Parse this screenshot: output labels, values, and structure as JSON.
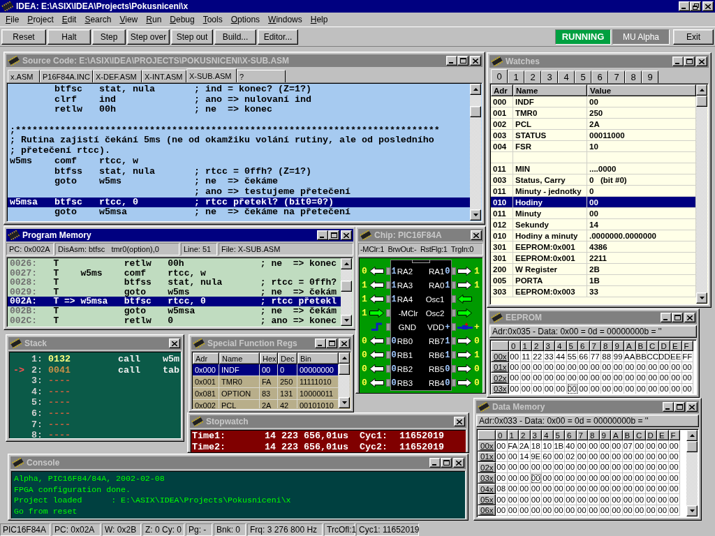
{
  "app": {
    "title": "IDEA: E:\\ASIX\\IDEA\\Projects\\Pokusniceni\\x"
  },
  "menu": [
    "File",
    "Project",
    "Edit",
    "Search",
    "View",
    "Run",
    "Debug",
    "Tools",
    "Options",
    "Windows",
    "Help"
  ],
  "toolbar": {
    "buttons": [
      "Reset",
      "Halt",
      "Step",
      "Step over",
      "Step out",
      "Build...",
      "Editor..."
    ],
    "status": {
      "label": "RUNNING",
      "on": true
    },
    "target": "MU Alpha",
    "exit": "Exit"
  },
  "source_window": {
    "title": "Source Code: E:\\ASIX\\IDEA\\PROJECTS\\POKUSNICENI\\X-SUB.ASM",
    "active": false,
    "kind": "full",
    "tabs": [
      {
        "label": "x.ASM",
        "selected": false
      },
      {
        "label": "P16F84A.INC",
        "selected": false
      },
      {
        "label": "X-DEF.ASM",
        "selected": false
      },
      {
        "label": "X-INT.ASM",
        "selected": false
      },
      {
        "label": "X-SUB.ASM",
        "selected": true
      },
      {
        "label": "?",
        "selected": false
      }
    ],
    "lines": [
      {
        "kind": "code",
        "text": "        btfsc   stat, nula       ; ind = konec? (Z=1?)",
        "selected": false
      },
      {
        "kind": "code",
        "text": "        clrf    ind              ; ano => nulovaní ind",
        "selected": false
      },
      {
        "kind": "code",
        "text": "        retlw   00h              ; ne  => konec",
        "selected": false
      },
      {
        "kind": "blank",
        "selected": false
      },
      {
        "kind": "code",
        "text": ";****************************************************************************",
        "selected": false
      },
      {
        "kind": "code",
        "text": "; Rutina zajistí čekání 5ms (ne od okamžiku volání rutiny, ale od posledního",
        "selected": false
      },
      {
        "kind": "code",
        "text": "; přetečení rtcc).",
        "selected": false
      },
      {
        "kind": "code",
        "text": "w5ms    comf    rtcc, w",
        "selected": false
      },
      {
        "kind": "code",
        "text": "        btfss   stat, nula       ; rtcc = 0ffh? (Z=1?)",
        "selected": false
      },
      {
        "kind": "code",
        "text": "        goto    w5ms             ; ne  => čekáme",
        "selected": false
      },
      {
        "kind": "code",
        "text": "                                 ; ano => testujeme přetečení",
        "selected": false
      },
      {
        "kind": "code",
        "text": "w5msa   btfsc   rtcc, 0          ; rtcc přetekl? (bit0=0?)",
        "selected": true
      },
      {
        "kind": "code",
        "text": "        goto    w5msa            ; ne  => čekáme na přetečení",
        "selected": false
      }
    ]
  },
  "watches": {
    "title": "Watches",
    "active": false,
    "kind": "full",
    "tabs": [
      {
        "label": "0",
        "selected": true
      },
      {
        "label": "1",
        "selected": false
      },
      {
        "label": "2",
        "selected": false
      },
      {
        "label": "3",
        "selected": false
      },
      {
        "label": "4",
        "selected": false
      },
      {
        "label": "5",
        "selected": false
      },
      {
        "label": "6",
        "selected": false
      },
      {
        "label": "7",
        "selected": false
      },
      {
        "label": "8",
        "selected": false
      },
      {
        "label": "9",
        "selected": false
      }
    ],
    "columns": [
      "Adr",
      "Name",
      "Value"
    ],
    "rows": [
      {
        "kind": "entry",
        "adr": "000",
        "name": "INDF",
        "value": "00",
        "selected": false
      },
      {
        "kind": "entry",
        "adr": "001",
        "name": "TMR0",
        "value": "250",
        "selected": false
      },
      {
        "kind": "entry",
        "adr": "002",
        "name": "PCL",
        "value": "2A",
        "selected": false
      },
      {
        "kind": "entry",
        "adr": "003",
        "name": "STATUS",
        "value": "00011000",
        "selected": false
      },
      {
        "kind": "entry",
        "adr": "004",
        "name": "FSR",
        "value": "10",
        "selected": false
      },
      {
        "kind": "blank",
        "selected": false
      },
      {
        "kind": "entry",
        "adr": "011",
        "name": "MIN",
        "value": "....0000",
        "selected": false
      },
      {
        "kind": "entry",
        "adr": "003",
        "name": "Status, Carry",
        "value": "0   (bit #0)",
        "selected": false
      },
      {
        "kind": "entry",
        "adr": "011",
        "name": "Minuty - jednotky",
        "value": "0",
        "selected": false
      },
      {
        "kind": "entry",
        "adr": "010",
        "name": "Hodiny",
        "value": "00",
        "selected": true
      },
      {
        "kind": "entry",
        "adr": "011",
        "name": "Minuty",
        "value": "00",
        "selected": false
      },
      {
        "kind": "entry",
        "adr": "012",
        "name": "Sekundy",
        "value": "14",
        "selected": false
      },
      {
        "kind": "entry",
        "adr": "010",
        "name": "Hodiny a minuty",
        "value": ".0000000.0000000",
        "selected": false
      },
      {
        "kind": "entry",
        "adr": "301",
        "name": "EEPROM:0x001",
        "value": "4386",
        "selected": false
      },
      {
        "kind": "entry",
        "adr": "301",
        "name": "EEPROM:0x001",
        "value": "2211",
        "selected": false
      },
      {
        "kind": "entry",
        "adr": "200",
        "name": "W Register",
        "value": "2B",
        "selected": false
      },
      {
        "kind": "entry",
        "adr": "005",
        "name": "PORTA",
        "value": "1B",
        "selected": false
      },
      {
        "kind": "entry",
        "adr": "303",
        "name": "EEPROM:0x003",
        "value": "33",
        "selected": false
      }
    ]
  },
  "program_memory": {
    "title": "Program Memory",
    "active": true,
    "kind": "full",
    "info": [
      "PC: 0x002A",
      "DisAsm: btfsc   tmr0(option),0",
      "Line: 51",
      "File: X-SUB.ASM"
    ],
    "lines": [
      {
        "address": "0026:",
        "text": "T            retlw   00h              ; ne  => konec",
        "selected": false
      },
      {
        "address": "0027:",
        "text": "T    w5ms    comf    rtcc, w",
        "selected": false
      },
      {
        "address": "0028:",
        "text": "T            btfss   stat, nula       ; rtcc = 0ffh?",
        "selected": false
      },
      {
        "address": "0029:",
        "text": "T            goto    w5ms             ; ne  => čekám",
        "selected": false
      },
      {
        "address": "002A:",
        "text": "T => w5msa   btfsc   rtcc, 0          ; rtcc přetekl",
        "selected": true
      },
      {
        "address": "002B:",
        "text": "T            goto    w5msa            ; ne  => čekám",
        "selected": false
      },
      {
        "address": "002C:",
        "text": "T            retlw   0                ; ano => konec",
        "selected": false
      }
    ]
  },
  "chip": {
    "title": "Chip: PIC16F84A",
    "active": false,
    "kind": "close_only",
    "status": "-MClr:1  BrwOut:-  RstFlg:1  TrgIn:0",
    "left_pins": [
      {
        "name": "RA2",
        "kind": "out",
        "color": "#ffffff",
        "inner": "1",
        "outer": "0"
      },
      {
        "name": "RA3",
        "kind": "out",
        "color": "#ffffff",
        "inner": "1",
        "outer": "1"
      },
      {
        "name": "RA4",
        "kind": "out",
        "color": "#ffffff",
        "inner": "1",
        "outer": "1"
      },
      {
        "name": "-MClr",
        "kind": "in",
        "color": "#00ff00",
        "outer": "1"
      },
      {
        "name": "GND",
        "kind": "ground"
      },
      {
        "name": "RB0",
        "kind": "out",
        "color": "#ffffff",
        "inner": "0",
        "outer": "0"
      },
      {
        "name": "RB1",
        "kind": "out",
        "color": "#ffffff",
        "inner": "0",
        "outer": "0"
      },
      {
        "name": "RB2",
        "kind": "out",
        "color": "#ffffff",
        "inner": "0",
        "outer": "0"
      },
      {
        "name": "RB3",
        "kind": "out",
        "color": "#ffffff",
        "inner": "0",
        "outer": "0"
      }
    ],
    "right_pins": [
      {
        "name": "RA1",
        "kind": "out",
        "color": "#ffffff",
        "inner": "0",
        "outer": "1"
      },
      {
        "name": "RA0",
        "kind": "out",
        "color": "#ffffff",
        "inner": "1",
        "outer": "1"
      },
      {
        "name": "Osc1",
        "kind": "in",
        "color": "#00ff00"
      },
      {
        "name": "Osc2",
        "kind": "out",
        "color": "#00ff00"
      },
      {
        "name": "VDD",
        "kind": "power",
        "inner": "+",
        "outer": "+"
      },
      {
        "name": "RB7",
        "kind": "out",
        "color": "#ffffff",
        "inner": "1",
        "outer": "0"
      },
      {
        "name": "RB6",
        "kind": "out",
        "color": "#ffffff",
        "inner": "1",
        "outer": "1"
      },
      {
        "name": "RB5",
        "kind": "out",
        "color": "#ffffff",
        "inner": "0",
        "outer": "0"
      },
      {
        "name": "RB4",
        "kind": "out",
        "color": "#ffffff",
        "inner": "0",
        "outer": "0"
      }
    ]
  },
  "stack": {
    "title": "Stack",
    "active": false,
    "kind": "close_only",
    "rows": [
      {
        "kind": "active",
        "number": "1:",
        "address": "0132",
        "instruction": "call",
        "target": "w5m"
      },
      {
        "kind": "return",
        "marker": "->",
        "number": "2:",
        "address": "0041",
        "instruction": "call",
        "target": "tab"
      },
      {
        "kind": "empty",
        "number": "3:",
        "address": "----"
      },
      {
        "kind": "empty",
        "number": "4:",
        "address": "----"
      },
      {
        "kind": "empty",
        "number": "5:",
        "address": "----"
      },
      {
        "kind": "empty",
        "number": "6:",
        "address": "----"
      },
      {
        "kind": "empty",
        "number": "7:",
        "address": "----"
      },
      {
        "kind": "empty",
        "number": "8:",
        "address": "----"
      }
    ]
  },
  "sfr": {
    "title": "Special Function Regs",
    "active": false,
    "kind": "full",
    "columns": [
      "Adr",
      "Name",
      "Hex",
      "Dec",
      "Bin"
    ],
    "rows": [
      {
        "cells": [
          "0x000",
          "INDF",
          "00",
          "0",
          "00000000"
        ],
        "selected": true
      },
      {
        "cells": [
          "0x001",
          "TMR0",
          "FA",
          "250",
          "11111010"
        ],
        "selected": false
      },
      {
        "cells": [
          "0x081",
          "OPTION",
          "83",
          "131",
          "10000011"
        ],
        "selected": false
      },
      {
        "cells": [
          "0x002",
          "PCL",
          "2A",
          "42",
          "00101010"
        ],
        "selected": false
      }
    ]
  },
  "stopwatch": {
    "title": "Stopwatch",
    "active": false,
    "kind": "close_only",
    "rows": [
      {
        "label": "Time1:",
        "time": "14 223 656,01us",
        "cycle_label": "Cyc1:",
        "cycles": "11652019"
      },
      {
        "label": "Time2:",
        "time": "14 223 656,01us",
        "cycle_label": "Cyc2:",
        "cycles": "11652019"
      }
    ]
  },
  "eeprom": {
    "title": "EEPROM",
    "active": false,
    "kind": "full",
    "info": "Adr:0x035 - Data: 0x00 = 0d = 00000000b = ''",
    "columns": [
      "0",
      "1",
      "2",
      "3",
      "4",
      "5",
      "6",
      "7",
      "8",
      "9",
      "A",
      "B",
      "C",
      "D",
      "E",
      "F"
    ],
    "rows": [
      {
        "label": "00x",
        "cells": [
          "00",
          "11",
          "22",
          "33",
          "44",
          "55",
          "66",
          "77",
          "88",
          "99",
          "AA",
          "BB",
          "CC",
          "DD",
          "EE",
          "FF"
        ]
      },
      {
        "label": "01x",
        "cells": [
          "00",
          "00",
          "00",
          "00",
          "00",
          "00",
          "00",
          "00",
          "00",
          "00",
          "00",
          "00",
          "00",
          "00",
          "00",
          "00"
        ]
      },
      {
        "label": "02x",
        "cells": [
          "00",
          "00",
          "00",
          "00",
          "00",
          "00",
          "00",
          "00",
          "00",
          "00",
          "00",
          "00",
          "00",
          "00",
          "00",
          "00"
        ]
      },
      {
        "label": "03x",
        "cells": [
          "00",
          "00",
          "00",
          "00",
          "00",
          {
            "value": "00",
            "focused": true
          },
          "00",
          "00",
          "00",
          "00",
          "00",
          "00",
          "00",
          "00",
          "00",
          "00"
        ]
      }
    ]
  },
  "data_memory": {
    "title": "Data Memory",
    "active": false,
    "kind": "full",
    "info": "Adr:0x033 - Data: 0x00 = 0d = 00000000b = ''",
    "columns": [
      "0",
      "1",
      "2",
      "3",
      "4",
      "5",
      "6",
      "7",
      "8",
      "9",
      "A",
      "B",
      "C",
      "D",
      "E",
      "F"
    ],
    "rows": [
      {
        "label": "00x",
        "cells": [
          "00",
          "FA",
          "2A",
          "18",
          "10",
          "1B",
          "40",
          "00",
          "00",
          "00",
          "00",
          "07",
          "00",
          "00",
          "00",
          "00"
        ]
      },
      {
        "label": "01x",
        "cells": [
          "00",
          "00",
          "14",
          "9E",
          "60",
          "00",
          "02",
          "00",
          "00",
          "00",
          "00",
          "00",
          "00",
          "00",
          "00",
          "00"
        ]
      },
      {
        "label": "02x",
        "cells": [
          "00",
          "00",
          "00",
          "00",
          "00",
          "00",
          "00",
          "00",
          "00",
          "00",
          "00",
          "00",
          "00",
          "00",
          "00",
          "00"
        ]
      },
      {
        "label": "03x",
        "cells": [
          "00",
          "00",
          "00",
          {
            "value": "00",
            "focused": true
          },
          "00",
          "00",
          "00",
          "00",
          "00",
          "00",
          "00",
          "00",
          "00",
          "00",
          "00",
          "00"
        ]
      },
      {
        "label": "04x",
        "cells": [
          "08",
          "00",
          "00",
          "00",
          "00",
          "00",
          "00",
          "00",
          "00",
          "00",
          "00",
          "00",
          "00",
          "00",
          "00",
          "00"
        ]
      },
      {
        "label": "05x",
        "cells": [
          "00",
          "00",
          "00",
          "00",
          "00",
          "00",
          "00",
          "00",
          "00",
          "00",
          "00",
          "00",
          "00",
          "00",
          "00",
          "00"
        ]
      },
      {
        "label": "06x",
        "cells": [
          "00",
          "00",
          "00",
          "00",
          "00",
          "00",
          "00",
          "00",
          "00",
          "00",
          "00",
          "00",
          "00",
          "00",
          "00",
          "00"
        ]
      }
    ]
  },
  "console": {
    "title": "Console",
    "active": false,
    "kind": "full",
    "lines": [
      "Alpha, PIC16F84/84A, 2002-02-08",
      "FPGA configuration done.",
      "Project loaded      : E:\\ASIX\\IDEA\\Projects\\Pokusniceni\\x",
      "Go from reset"
    ]
  },
  "status_bar": [
    "PIC16F84A",
    "PC: 0x02A",
    "W: 0x2B",
    "Z: 0 Cy: 0",
    "Pg: -",
    "Bnk: 0",
    "Frq: 3 276 800 Hz",
    "TrcOfl:1",
    "Cyc1:    11652019"
  ]
}
